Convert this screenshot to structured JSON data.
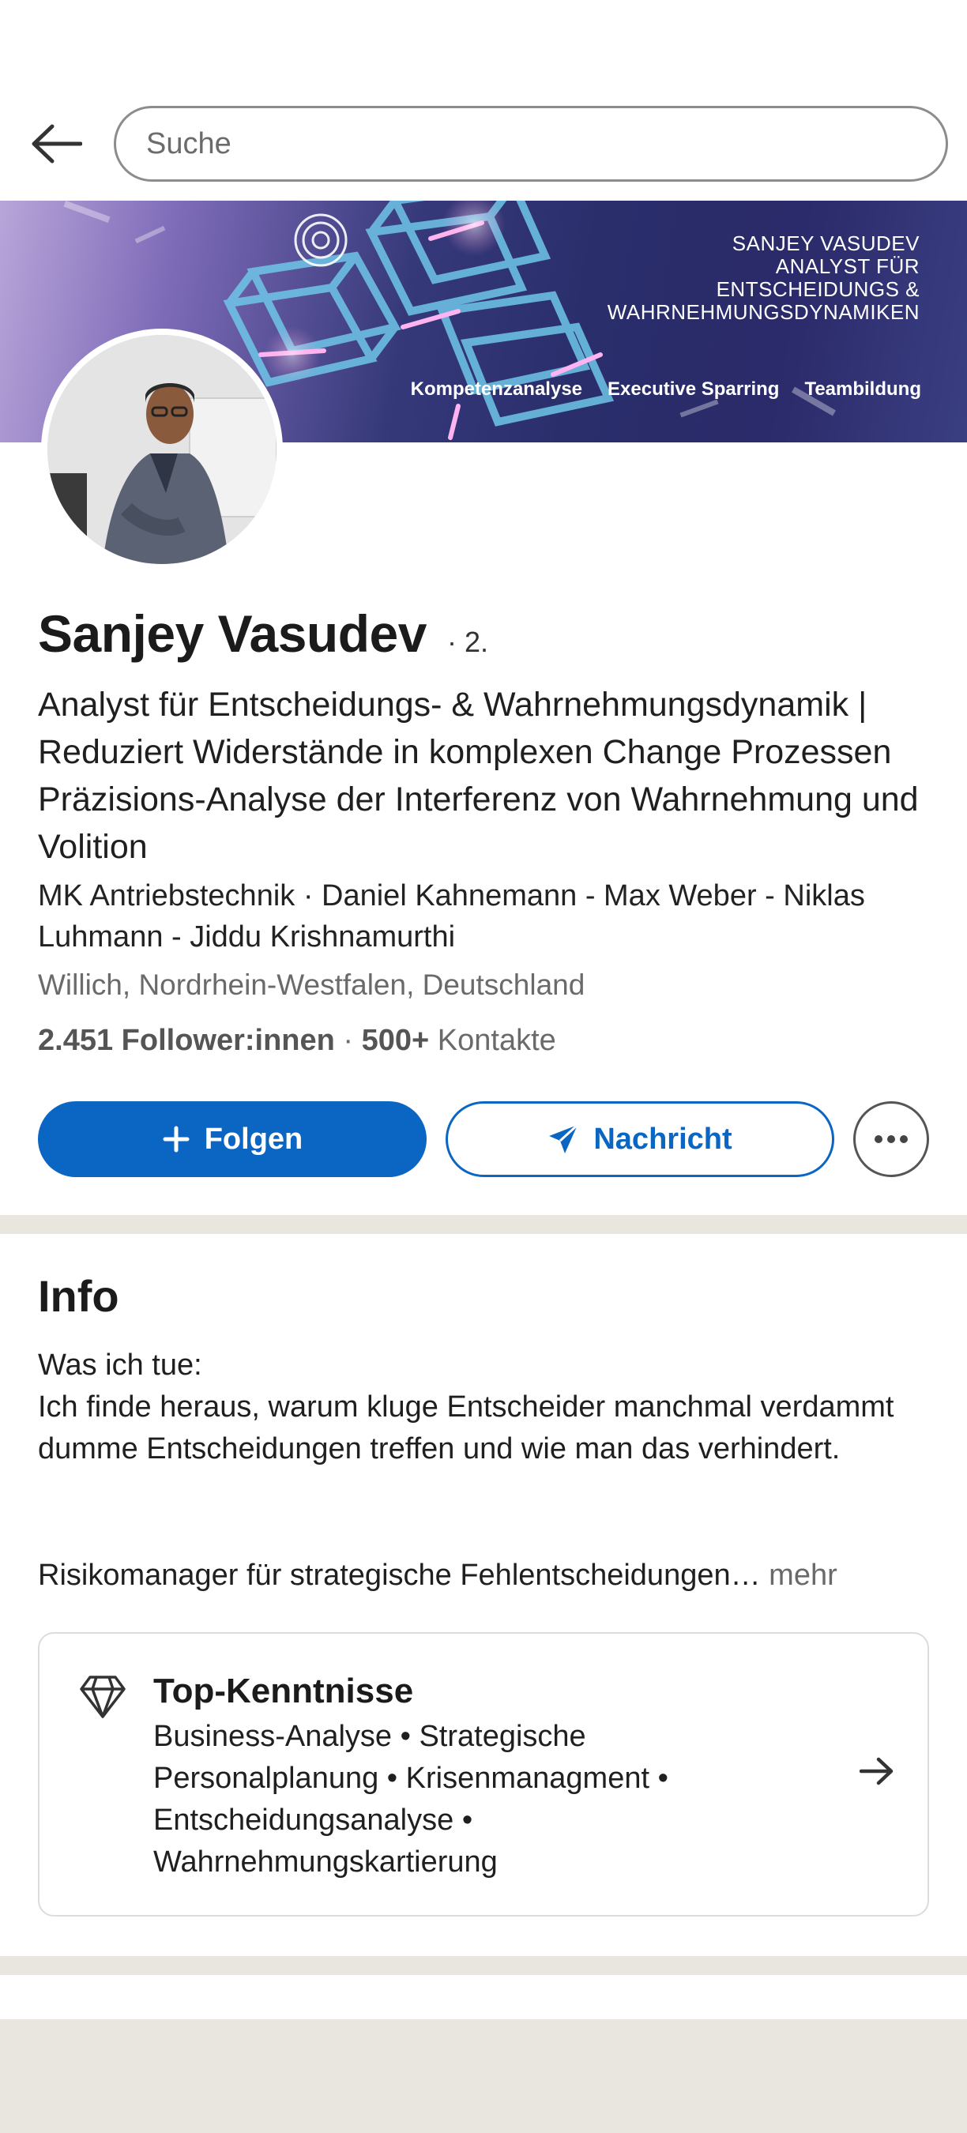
{
  "search": {
    "placeholder": "Suche"
  },
  "banner": {
    "title_lines": [
      "SANJEY VASUDEV",
      "ANALYST FÜR",
      "ENTSCHEIDUNGS &",
      "WAHRNEHMUNGSDYNAMIKEN"
    ],
    "tags": [
      "Kompetenzanalyse",
      "Executive Sparring",
      "Teambildung"
    ]
  },
  "profile": {
    "name": "Sanjey Vasudev",
    "degree": "· 2.",
    "headline": "Analyst für Entscheidungs- & Wahrnehmungsdynamik | Reduziert Widerstände in komplexen Change Prozessen Präzisions-Analyse der Interferenz von Wahrnehmung und Volition",
    "company": "MK Antriebstechnik  · Daniel Kahnemann - Max Weber - Niklas Luhmann - Jiddu Krishnamurthi",
    "location": "Willich, Nordrhein-Westfalen, Deutschland",
    "followers": "2.451 Follower:innen",
    "separator": " · ",
    "connections_count": "500+",
    "connections_label": " Kontakte"
  },
  "actions": {
    "follow_label": "Folgen",
    "message_label": "Nachricht"
  },
  "info": {
    "title": "Info",
    "body": "Was ich tue:\nIch finde heraus, warum kluge Entscheider manchmal verdammt dumme Entscheidungen treffen und wie man das verhindert.",
    "last_line": "Risikomanager für strategische Fehlentscheidungen…",
    "more_label": " mehr"
  },
  "skills": {
    "title": "Top-Kenntnisse",
    "text": "Business-Analyse • Strategische Personalplanung • Krisenmanagment • Entscheidungsanalyse • Wahrnehmungskartierung"
  },
  "colors": {
    "primary": "#0a66c2",
    "divider": "#e9e5df"
  }
}
